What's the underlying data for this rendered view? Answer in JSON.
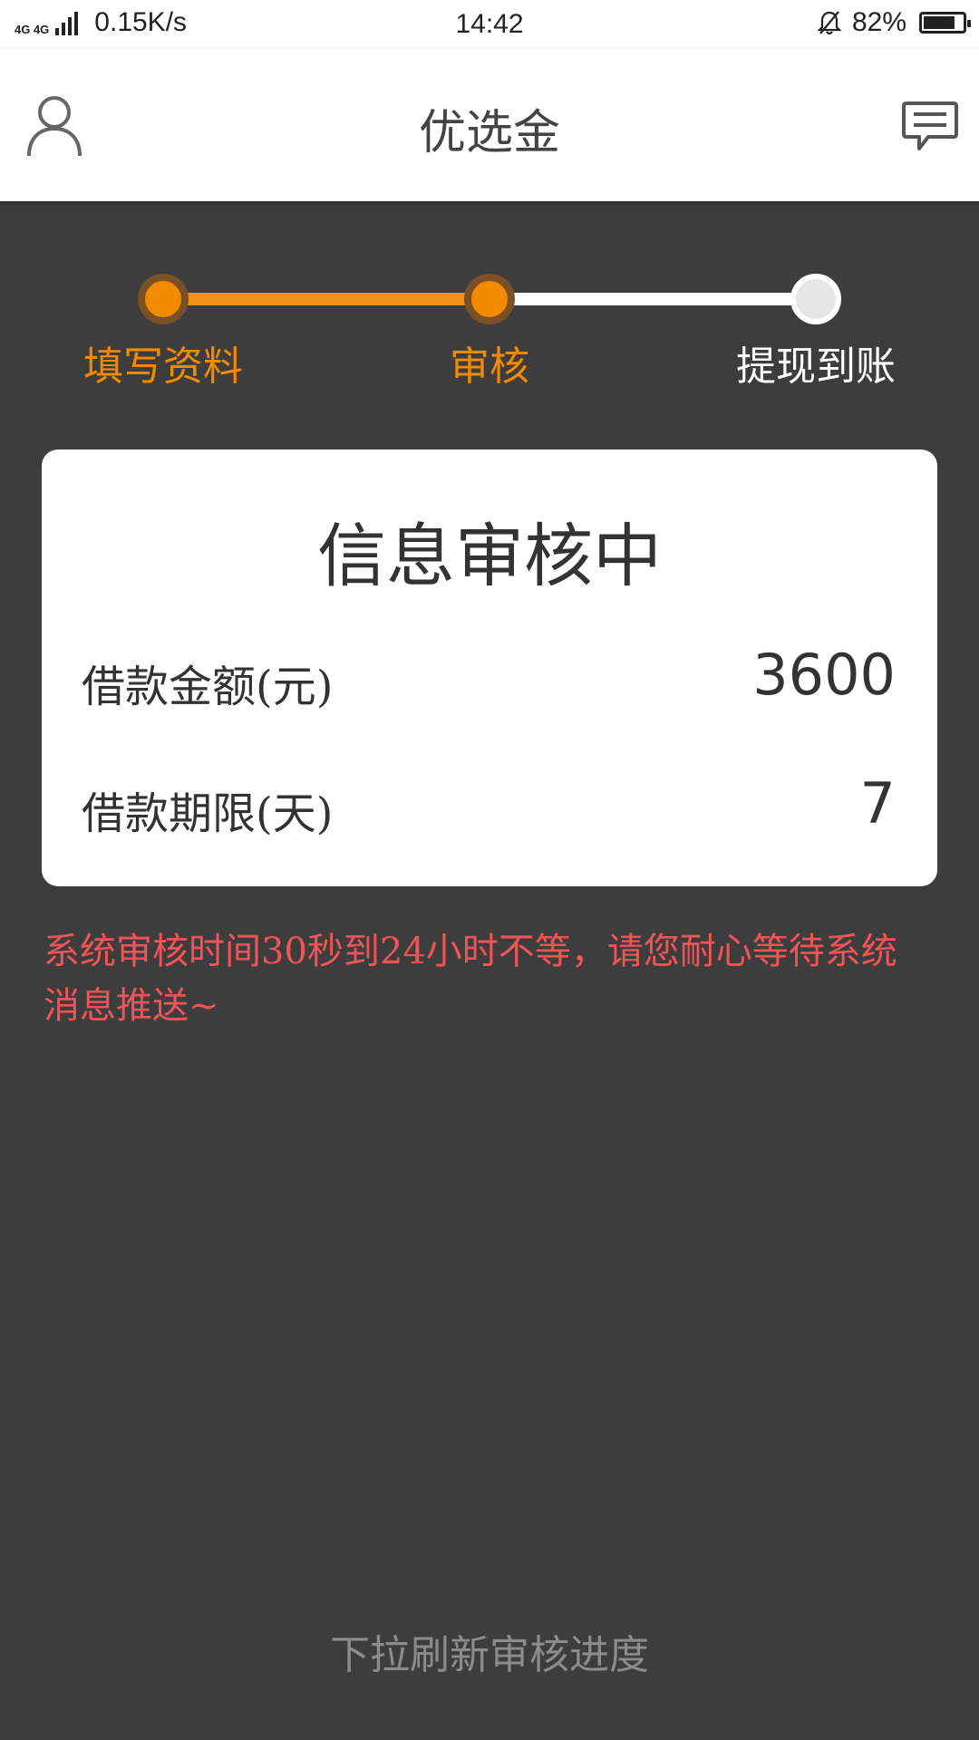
{
  "status_bar": {
    "network": "4G 4G",
    "speed": "0.15K/s",
    "time": "14:42",
    "battery": "82%",
    "battery_level": 0.82
  },
  "header": {
    "title": "优选金",
    "left_icon": "user-icon",
    "right_icon": "message-icon"
  },
  "steps": [
    {
      "label": "填写资料",
      "state": "done"
    },
    {
      "label": "审核",
      "state": "done"
    },
    {
      "label": "提现到账",
      "state": "pending"
    }
  ],
  "card": {
    "title": "信息审核中",
    "rows": [
      {
        "label": "借款金额(元)",
        "value": "3600"
      },
      {
        "label": "借款期限(天)",
        "value": "7"
      }
    ]
  },
  "notice": "系统审核时间30秒到24小时不等，请您耐心等待系统消息推送~",
  "pull_hint": "下拉刷新审核进度",
  "colors": {
    "accent": "#f28a00",
    "background": "#3d3d3d",
    "notice": "#f05456"
  }
}
